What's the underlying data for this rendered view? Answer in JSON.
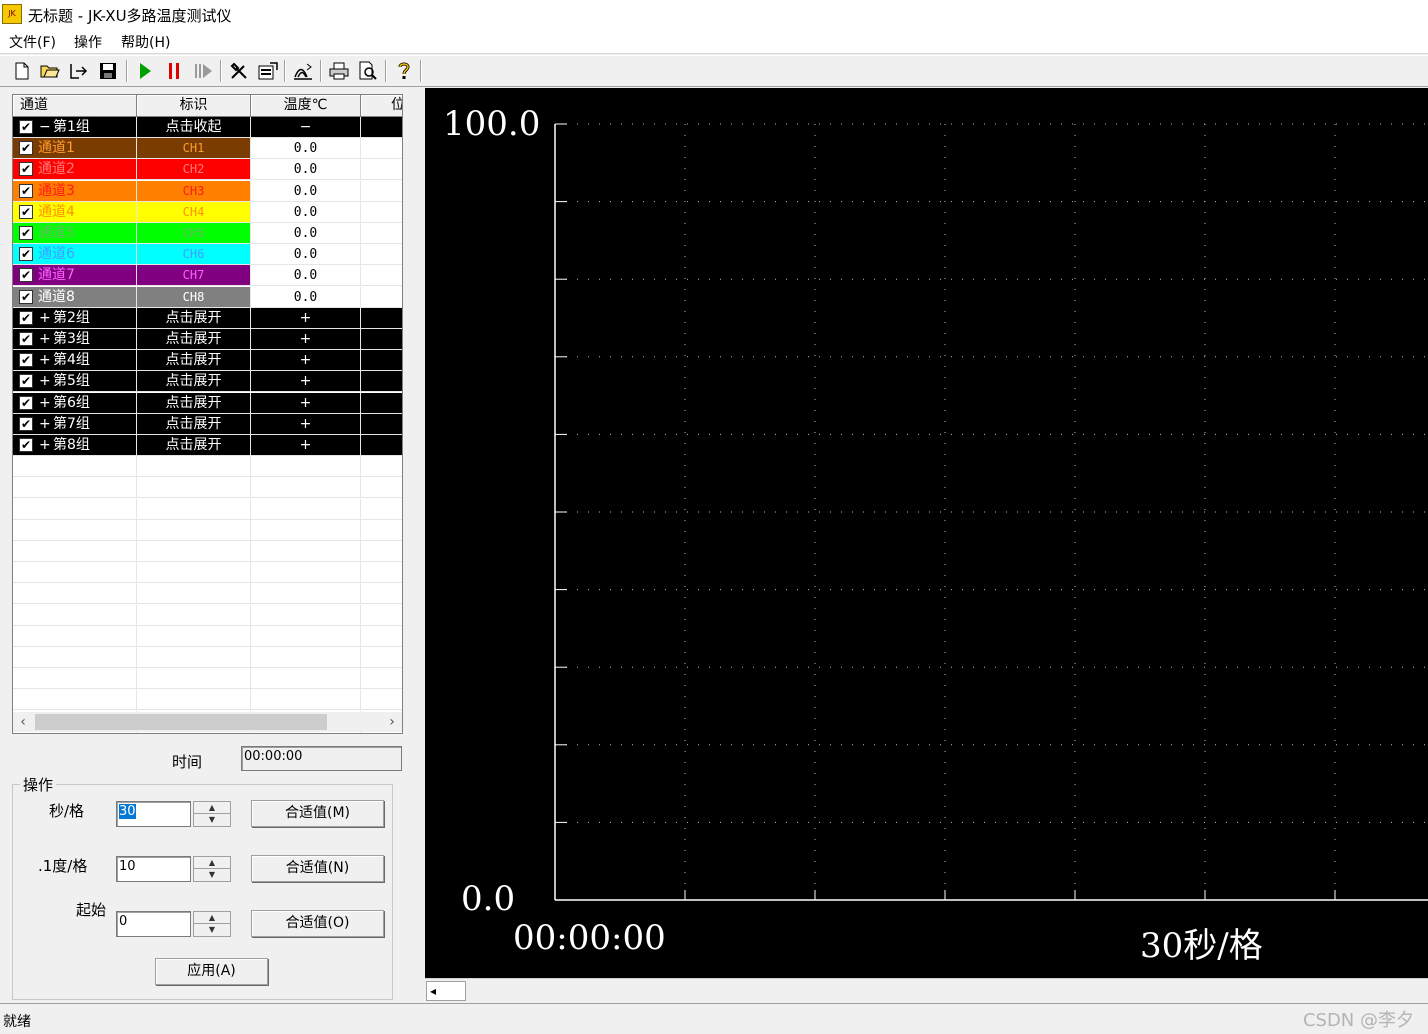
{
  "window": {
    "title": "无标题 - JK-XU多路温度测试仪",
    "app_icon_text": "JK"
  },
  "menu": [
    "文件(F)",
    "操作",
    "帮助(H)"
  ],
  "toolbar": [
    "new-icon",
    "open-icon",
    "export-icon",
    "save-icon",
    "play-icon",
    "pause-icon",
    "step-icon",
    "tools-icon",
    "settings-icon",
    "signal-icon",
    "print-icon",
    "print-preview-icon",
    "help-icon"
  ],
  "grid": {
    "headers": [
      "通道",
      "标识",
      "温度℃",
      "位"
    ],
    "group1": {
      "toggle": "−",
      "name": "第1组",
      "label": "点击收起",
      "value": "−"
    },
    "channels": [
      {
        "name": "通道1",
        "label": "CH1",
        "value": "0.0",
        "color": "#7a3c00",
        "text": "#ff9a30"
      },
      {
        "name": "通道2",
        "label": "CH2",
        "value": "0.0",
        "color": "#ff0000",
        "text": "#ff7a7a"
      },
      {
        "name": "通道3",
        "label": "CH3",
        "value": "0.0",
        "color": "#ff8000",
        "text": "#ff1a1a"
      },
      {
        "name": "通道4",
        "label": "CH4",
        "value": "0.0",
        "color": "#ffff00",
        "text": "#ff9000"
      },
      {
        "name": "通道5",
        "label": "CH5",
        "value": "0.0",
        "color": "#00ff00",
        "text": "#66b866"
      },
      {
        "name": "通道6",
        "label": "CH6",
        "value": "0.0",
        "color": "#00ffff",
        "text": "#40a0ff"
      },
      {
        "name": "通道7",
        "label": "CH7",
        "value": "0.0",
        "color": "#800080",
        "text": "#ff60ff"
      },
      {
        "name": "通道8",
        "label": "CH8",
        "value": "0.0",
        "color": "#808080",
        "text": "#ffffff"
      }
    ],
    "groups": [
      {
        "toggle": "+",
        "name": "第2组",
        "label": "点击展开",
        "value": "+"
      },
      {
        "toggle": "+",
        "name": "第3组",
        "label": "点击展开",
        "value": "+"
      },
      {
        "toggle": "+",
        "name": "第4组",
        "label": "点击展开",
        "value": "+"
      },
      {
        "toggle": "+",
        "name": "第5组",
        "label": "点击展开",
        "value": "+"
      },
      {
        "toggle": "+",
        "name": "第6组",
        "label": "点击展开",
        "value": "+"
      },
      {
        "toggle": "+",
        "name": "第7组",
        "label": "点击展开",
        "value": "+"
      },
      {
        "toggle": "+",
        "name": "第8组",
        "label": "点击展开",
        "value": "+"
      }
    ],
    "checkmark": "✔"
  },
  "controls": {
    "time_label": "时间",
    "time_value": "00:00:00",
    "group_title": "操作",
    "sec_per_div_label": "秒/格",
    "sec_per_div_value": "30",
    "deg_per_div_label": ".1度/格",
    "deg_per_div_value": "10",
    "start_label": "起始",
    "start_value": "0",
    "fit_m": "合适值(M)",
    "fit_n": "合适值(N)",
    "fit_o": "合适值(O)",
    "apply": "应用(A)"
  },
  "chart": {
    "y_max_label": "100.0",
    "y_min_label": "0.0",
    "x_start_label": "00:00:00",
    "scale_label": "30秒/格"
  },
  "status": {
    "text": "就绪",
    "watermark": "CSDN @李夕"
  }
}
